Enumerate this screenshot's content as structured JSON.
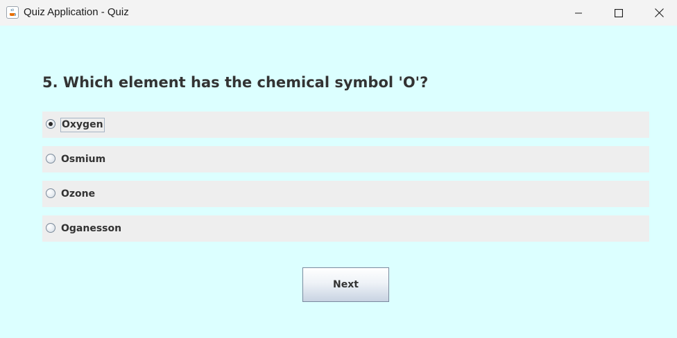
{
  "window": {
    "title": "Quiz Application - Quiz",
    "icon": "java-cup-icon",
    "controls": [
      "minimize-icon",
      "maximize-icon",
      "close-icon"
    ]
  },
  "quiz": {
    "question": "5. Which element has the chemical symbol 'O'?",
    "options": [
      {
        "label": "Oxygen",
        "selected": true
      },
      {
        "label": "Osmium",
        "selected": false
      },
      {
        "label": "Ozone",
        "selected": false
      },
      {
        "label": "Oganesson",
        "selected": false
      }
    ],
    "next_label": "Next"
  },
  "colors": {
    "background": "#dcffff",
    "option_background": "#eeeeee",
    "text": "#333333"
  }
}
